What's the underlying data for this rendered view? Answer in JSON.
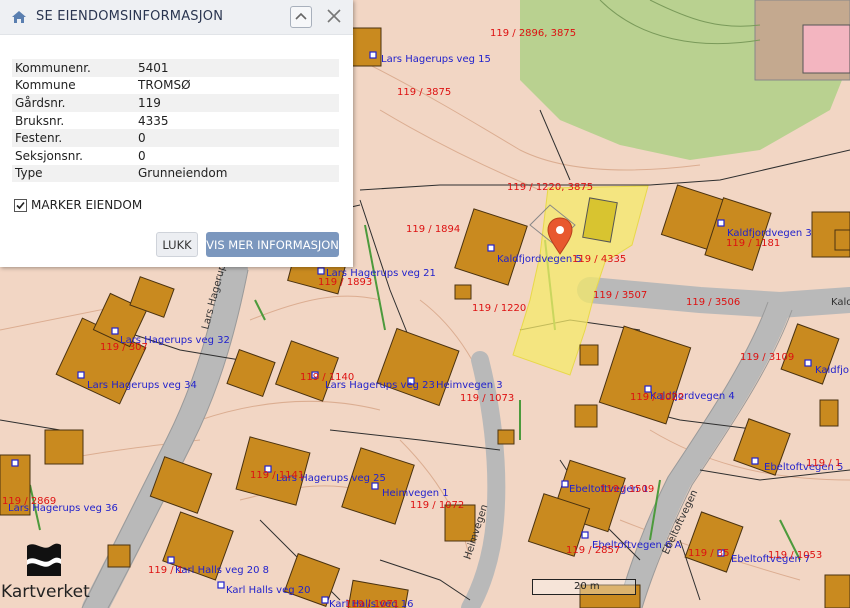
{
  "panel": {
    "title": "SE EIENDOMSINFORMASJON",
    "rows": [
      {
        "key": "Kommunenr.",
        "value": "5401"
      },
      {
        "key": "Kommune",
        "value": "TROMSØ"
      },
      {
        "key": "Gårdsnr.",
        "value": "119"
      },
      {
        "key": "Bruksnr.",
        "value": "4335"
      },
      {
        "key": "Festenr.",
        "value": "0"
      },
      {
        "key": "Seksjonsnr.",
        "value": "0"
      },
      {
        "key": "Type",
        "value": "Grunneiendom"
      }
    ],
    "mark_label": "MARKER EIENDOM",
    "mark_checked": true,
    "close_button": "LUKK",
    "more_button": "VIS MER INFORMASJON"
  },
  "map": {
    "address_labels": [
      "Lars Hagerups veg 15",
      "Lars Hagerups veg 21",
      "Kaldfjordvegen 5",
      "Kaldfjordvegen 3",
      "Lars Hagerups veg 32",
      "Lars Hagerups veg 34",
      "Lars Hagerups veg 23",
      "Heimvegen 3",
      "Kaldfjordvegen 4",
      "Kaldfjo",
      "Lars Hagerups veg 25",
      "Heimvegen 1",
      "Ebeltoftvegen 1",
      "Ebeltoftvegen 5",
      "Lars Hagerups veg 36",
      "Karl Halls veg 20 8",
      "Karl Halls veg 20",
      "Ebeltoftvegen 6 A",
      "Ebeltoftvegen 7",
      "Karl Halls veg 16"
    ],
    "parcel_labels": [
      "119 / 2896, 3875",
      "119 / 3875",
      "119 / 1220, 3875",
      "119 / 1894",
      "119 / 1893",
      "119 / 1220",
      "119 / 4335",
      "119 / 3507",
      "119 / 3506",
      "119 / 1181",
      "119 / 307",
      "119 / 1140",
      "119 / 1073",
      "119 / 3109",
      "119 / 1022",
      "119 / 1141",
      "119 / 1072",
      "119 / 1509",
      "119 / 1",
      "119 / 2869",
      "119 / 2857",
      "119 / 35",
      "119 / 1053",
      "119 / 1071",
      "119 / 1"
    ],
    "road_labels": [
      "Lars Hagerups veg",
      "Heimvegen",
      "Ebeltoftvegen",
      "Kalo"
    ],
    "scale_label": "20 m",
    "logo_text": "Kartverket"
  },
  "colors": {
    "header_bg": "#eef0f3",
    "button_primary": "#7b97be",
    "building": "#c98a1f",
    "selected_parcel": "#f4ea6a",
    "pin": "#e8582e"
  }
}
